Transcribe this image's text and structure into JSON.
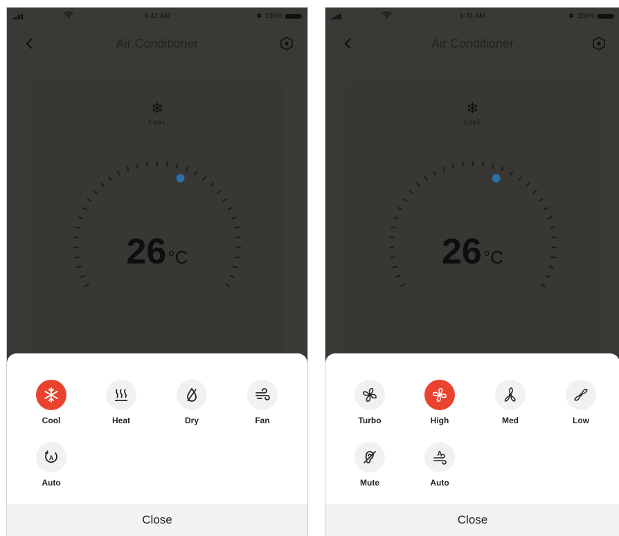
{
  "status_bar": {
    "time": "9:41 AM",
    "battery": "100%"
  },
  "screens": [
    {
      "title": "Air Conditioner",
      "current_mode": {
        "icon": "snowflake-icon",
        "label": "Cool"
      },
      "temperature": {
        "value": "26",
        "unit": "°C",
        "dial_level": 0.5
      },
      "sheet": {
        "options": [
          {
            "label": "Cool",
            "icon": "snowflake-icon",
            "selected": true
          },
          {
            "label": "Heat",
            "icon": "heat-icon",
            "selected": false
          },
          {
            "label": "Dry",
            "icon": "dry-drop-icon",
            "selected": false
          },
          {
            "label": "Fan",
            "icon": "wind-icon",
            "selected": false
          },
          {
            "label": "Auto",
            "icon": "auto-mode-icon",
            "selected": false
          }
        ],
        "close_label": "Close"
      }
    },
    {
      "title": "Air Conditioner",
      "current_mode": {
        "icon": "snowflake-icon",
        "label": "Cool"
      },
      "temperature": {
        "value": "26",
        "unit": "°C",
        "dial_level": 0.5
      },
      "sheet": {
        "options": [
          {
            "label": "Turbo",
            "icon": "fan-turbo-icon",
            "selected": false
          },
          {
            "label": "High",
            "icon": "fan-high-icon",
            "selected": true
          },
          {
            "label": "Med",
            "icon": "fan-med-icon",
            "selected": false
          },
          {
            "label": "Low",
            "icon": "fan-low-icon",
            "selected": false
          },
          {
            "label": "Mute",
            "icon": "mute-ear-icon",
            "selected": false
          },
          {
            "label": "Auto",
            "icon": "fan-auto-icon",
            "selected": false
          }
        ],
        "close_label": "Close"
      }
    }
  ],
  "colors": {
    "accent": "#e9432f",
    "overlay": "#3b3936",
    "dial_dot": "#2d6fa8",
    "sheet": "#ffffff"
  }
}
